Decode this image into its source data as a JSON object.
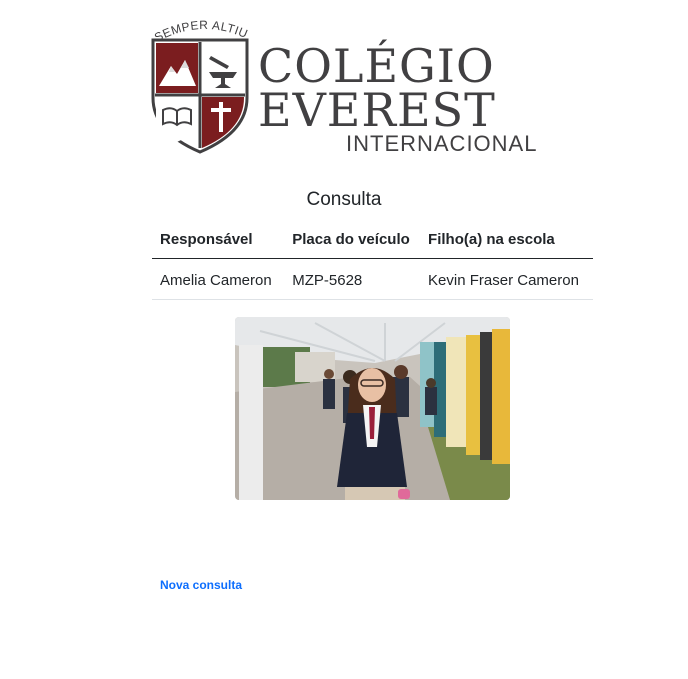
{
  "logo": {
    "motto": "SEMPER ALTIUS",
    "name_line1": "COLÉGIO",
    "name_line2": "EVEREST",
    "name_line3": "INTERNACIONAL",
    "colors": {
      "shield_red": "#7b1d1f",
      "text_gray": "#414042"
    }
  },
  "page": {
    "title": "Consulta"
  },
  "table": {
    "headers": [
      "Responsável",
      "Placa do veículo",
      "Filho(a) na escola"
    ],
    "rows": [
      [
        "Amelia Cameron",
        "MZP-5628",
        "Kevin Fraser Cameron"
      ]
    ]
  },
  "photo": {
    "icon": "school-students-photo"
  },
  "actions": {
    "new_query_label": "Nova consulta"
  },
  "colors": {
    "link": "#0d6efd",
    "text": "#212529"
  }
}
